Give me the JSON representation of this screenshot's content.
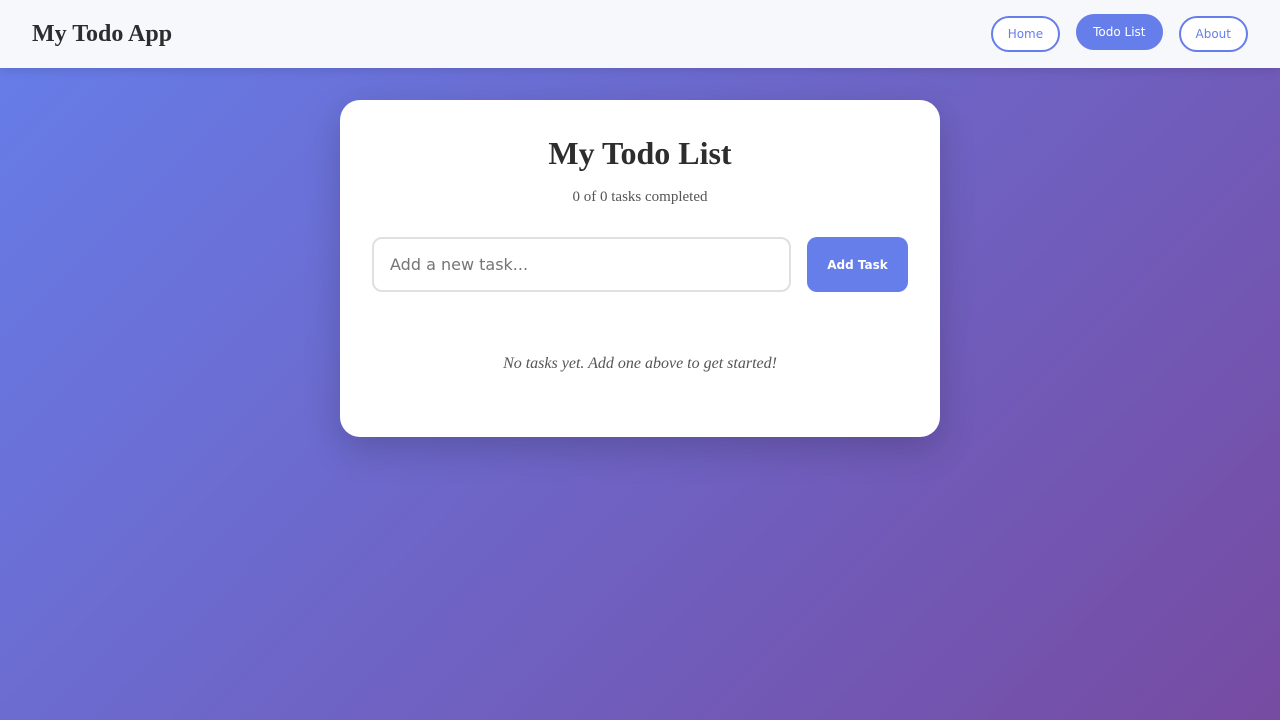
{
  "navbar": {
    "brand": "My Todo App",
    "links": [
      {
        "label": "Home"
      },
      {
        "label": "Todo List"
      },
      {
        "label": "About"
      }
    ]
  },
  "todo": {
    "title": "My Todo List",
    "count_text": "0 of 0 tasks completed",
    "input": {
      "value": "",
      "placeholder": "Add a new task..."
    },
    "add_button_label": "Add Task",
    "empty_message": "No tasks yet. Add one above to get started!"
  },
  "colors": {
    "accent": "#667eea",
    "gradient_start": "#667eea",
    "gradient_end": "#764ba2"
  }
}
